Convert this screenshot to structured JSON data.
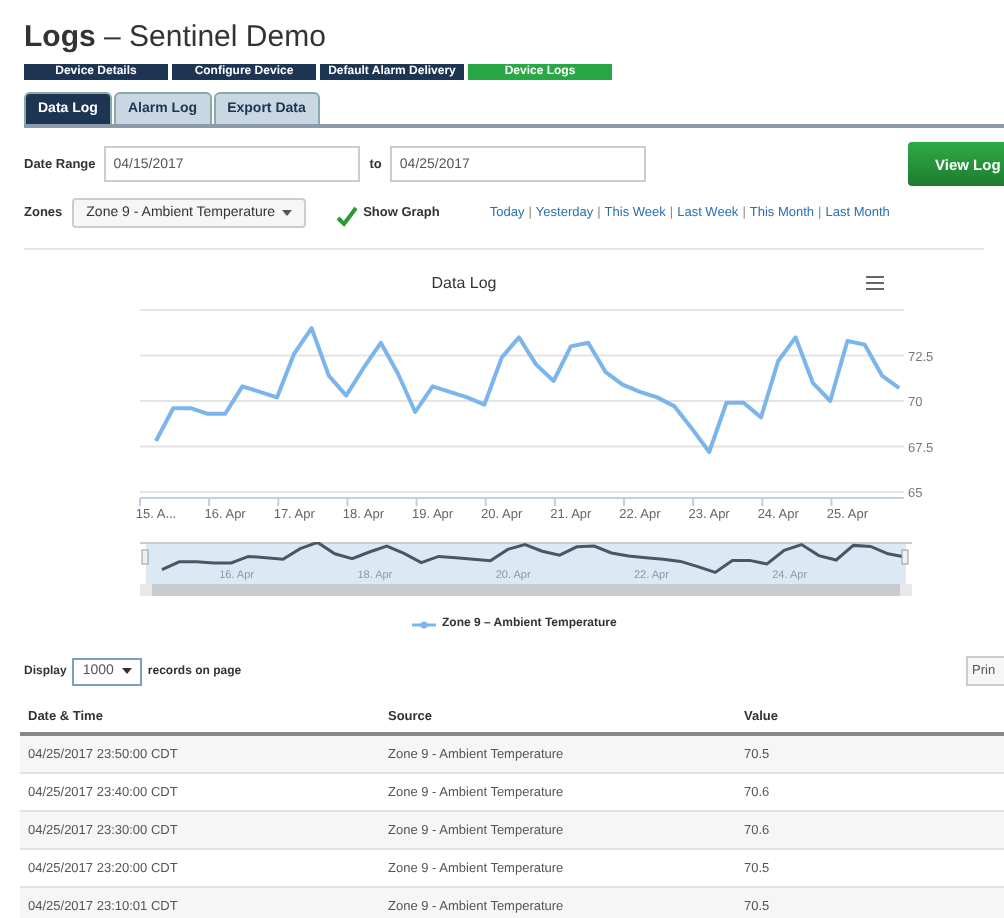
{
  "page": {
    "title_bold": "Logs",
    "title_sep": "–",
    "title_rest": "Sentinel Demo"
  },
  "nav_buttons": [
    {
      "label": "Device Details",
      "selected": false
    },
    {
      "label": "Configure Device",
      "selected": false
    },
    {
      "label": "Default Alarm Delivery",
      "selected": false
    },
    {
      "label": "Device Logs",
      "selected": true
    }
  ],
  "tabs": [
    {
      "label": "Data Log",
      "selected": true
    },
    {
      "label": "Alarm Log",
      "selected": false
    },
    {
      "label": "Export Data",
      "selected": false
    }
  ],
  "date_range": {
    "label": "Date Range",
    "from": "04/15/2017",
    "to_label": "to",
    "to": "04/25/2017",
    "button": "View Log"
  },
  "zones": {
    "label": "Zones",
    "value": "Zone 9 - Ambient Temperature",
    "show_graph": {
      "label": "Show Graph",
      "checked": true
    },
    "quick_ranges": [
      "Today",
      "Yesterday",
      "This Week",
      "Last Week",
      "This Month",
      "Last Month"
    ],
    "separator": "|"
  },
  "chart": {
    "chart_data": {
      "type": "line",
      "title": "Data Log",
      "categories": [
        "15. A...",
        null,
        null,
        null,
        "16. Apr",
        null,
        null,
        null,
        "17. Apr",
        null,
        null,
        null,
        "18. Apr",
        null,
        null,
        null,
        "19. Apr",
        null,
        null,
        null,
        "20. Apr",
        null,
        null,
        null,
        "21. Apr",
        null,
        null,
        null,
        "22. Apr",
        null,
        null,
        null,
        "23. Apr",
        null,
        null,
        null,
        "24. Apr",
        null,
        null,
        null,
        "25. Apr",
        null,
        null,
        null
      ],
      "series": [
        {
          "name": "Zone 9 – Ambient Temperature",
          "color": "#7cb5ec",
          "values": [
            67.8,
            69.6,
            69.6,
            69.3,
            69.3,
            70.8,
            70.5,
            70.2,
            72.6,
            74.0,
            71.4,
            70.3,
            71.8,
            73.2,
            71.5,
            69.4,
            70.8,
            70.5,
            70.2,
            69.8,
            72.4,
            73.5,
            72.0,
            71.1,
            73.0,
            73.2,
            71.6,
            70.9,
            70.5,
            70.2,
            69.7,
            68.5,
            67.2,
            69.9,
            69.9,
            69.1,
            72.2,
            73.5,
            71.0,
            70.0,
            73.3,
            73.1,
            71.4,
            70.7
          ]
        }
      ],
      "grid": true,
      "ylim": [
        65,
        75
      ],
      "yticks": [
        {
          "value": 65,
          "label": "65"
        },
        {
          "value": 67.5,
          "label": "67.5"
        },
        {
          "value": 70,
          "label": "70"
        },
        {
          "value": 72.5,
          "label": "72.5"
        }
      ]
    },
    "navigator_labels": [
      "16. Apr",
      "18. Apr",
      "20. Apr",
      "22. Apr",
      "24. Apr"
    ]
  },
  "display": {
    "label": "Display",
    "value": "1000",
    "suffix": "records on page",
    "print": "Prin"
  },
  "table": {
    "columns": [
      "Date & Time",
      "Source",
      "Value"
    ],
    "rows": [
      [
        "04/25/2017 23:50:00 CDT",
        "Zone 9 - Ambient Temperature",
        "70.5"
      ],
      [
        "04/25/2017 23:40:00 CDT",
        "Zone 9 - Ambient Temperature",
        "70.6"
      ],
      [
        "04/25/2017 23:30:00 CDT",
        "Zone 9 - Ambient Temperature",
        "70.6"
      ],
      [
        "04/25/2017 23:20:00 CDT",
        "Zone 9 - Ambient Temperature",
        "70.5"
      ],
      [
        "04/25/2017 23:10:01 CDT",
        "Zone 9 - Ambient Temperature",
        "70.5"
      ]
    ]
  }
}
